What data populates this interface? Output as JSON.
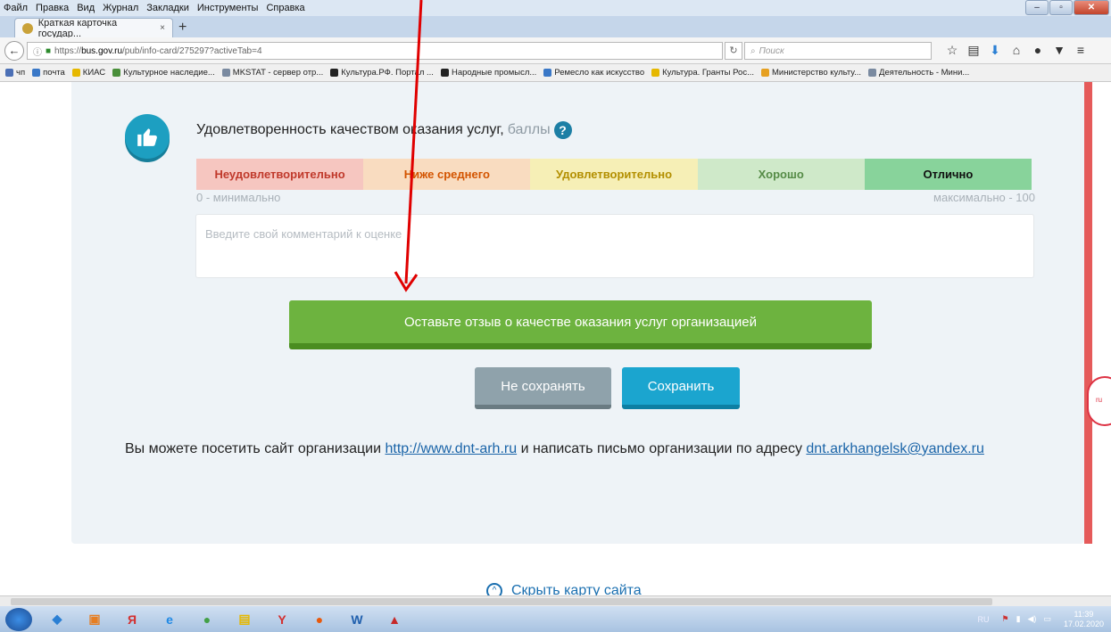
{
  "menu": [
    "Файл",
    "Правка",
    "Вид",
    "Журнал",
    "Закладки",
    "Инструменты",
    "Справка"
  ],
  "tab": {
    "title": "Краткая карточка государ...",
    "close": "×",
    "new_tab": "+"
  },
  "nav": {
    "url_prefix": "https://",
    "url_host": "bus.gov.ru",
    "url_path": "/pub/info-card/275297?activeTab=4",
    "search_placeholder": "Поиск"
  },
  "bookmarks": [
    {
      "label": "чп",
      "color": "#4b6fb5"
    },
    {
      "label": "почта",
      "color": "#3a78c7"
    },
    {
      "label": "КИАС",
      "color": "#e6b800"
    },
    {
      "label": "Культурное наследие...",
      "color": "#4a8f3a"
    },
    {
      "label": "MKSTAT - сервер отр...",
      "color": "#7a8aa0"
    },
    {
      "label": "Культура.РФ. Портал ...",
      "color": "#222222"
    },
    {
      "label": "Народные промысл...",
      "color": "#222222"
    },
    {
      "label": "Ремесло как искусство",
      "color": "#3a78c7"
    },
    {
      "label": "Культура. Гранты Рос...",
      "color": "#e6b800"
    },
    {
      "label": "Министерство культу...",
      "color": "#e6a020"
    },
    {
      "label": "Деятельность - Мини...",
      "color": "#7a8aa0"
    }
  ],
  "rating": {
    "title": "Удовлетворенность качеством оказания услуг,",
    "units": "баллы",
    "help": "?",
    "levels": [
      {
        "label": "Неудовлетворительно",
        "bg": "#f6c6c0",
        "fg": "#c0392b"
      },
      {
        "label": "Ниже среднего",
        "bg": "#f9dcc0",
        "fg": "#d35400"
      },
      {
        "label": "Удовлетворительно",
        "bg": "#f6efb6",
        "fg": "#b38f00"
      },
      {
        "label": "Хорошо",
        "bg": "#cfe9c9",
        "fg": "#558b46"
      },
      {
        "label": "Отлично",
        "bg": "#88d39b",
        "fg": "#111111"
      }
    ],
    "min_label": "0 - минимально",
    "max_label": "максимально - 100",
    "comment_placeholder": "Введите свой комментарий к оценке"
  },
  "buttons": {
    "feedback": "Оставьте отзыв о качестве оказания услуг организацией",
    "no_save": "Не сохранять",
    "save": "Сохранить"
  },
  "visit": {
    "text1": "Вы можете посетить сайт организации",
    "site_link": "http://www.dnt-arh.ru",
    "text2": "и написать письмо организации по адресу",
    "email_link": "dnt.arkhangelsk@yandex.ru"
  },
  "sitemap": {
    "hide_label": "Скрыть карту сайта"
  },
  "side_badge": "ru",
  "taskbar": {
    "apps": [
      {
        "name": "ie-shortcut",
        "glyph": "◆",
        "color": "#2a7fd4"
      },
      {
        "name": "media-app",
        "glyph": "▣",
        "color": "#e67e22"
      },
      {
        "name": "yandex-app",
        "glyph": "Я",
        "color": "#d32f2f"
      },
      {
        "name": "internet-explorer",
        "glyph": "e",
        "color": "#1e88e5"
      },
      {
        "name": "chrome",
        "glyph": "●",
        "color": "#43a047"
      },
      {
        "name": "file-explorer",
        "glyph": "▤",
        "color": "#e6b800"
      },
      {
        "name": "yandex-browser",
        "glyph": "Y",
        "color": "#d32f2f"
      },
      {
        "name": "firefox",
        "glyph": "●",
        "color": "#e8590c"
      },
      {
        "name": "word",
        "glyph": "W",
        "color": "#1f5fad"
      },
      {
        "name": "acrobat",
        "glyph": "▲",
        "color": "#c62828"
      }
    ],
    "lang": "RU",
    "time": "11:39",
    "date": "17.02.2020"
  },
  "colors": {
    "accent_green": "#6db33f",
    "accent_blue": "#1ba5cf",
    "arrow": "#e00000"
  }
}
